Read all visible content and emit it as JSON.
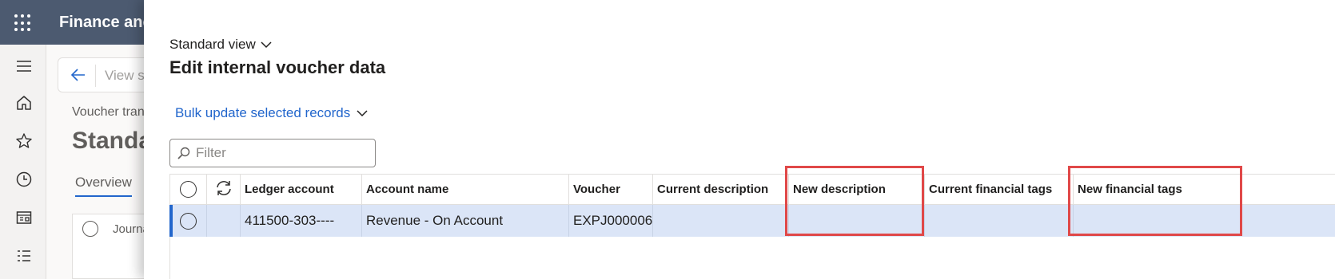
{
  "app": {
    "title": "Finance and"
  },
  "left_rail": {
    "icons": [
      "menu-icon",
      "home-icon",
      "star-icon",
      "clock-icon",
      "workspace-icon",
      "list-icon"
    ]
  },
  "background": {
    "back_text": "View s",
    "breadcrumb": "Voucher tran",
    "title": "Standa",
    "tab_overview": "Overview",
    "grid_first_col": "Journa"
  },
  "panel": {
    "view_selector": "Standard view",
    "title": "Edit internal voucher data",
    "bulk_update": "Bulk update selected records",
    "filter": {
      "placeholder": "Filter",
      "value": ""
    },
    "columns": [
      "Ledger account",
      "Account name",
      "Voucher",
      "Current description",
      "New description",
      "Current financial tags",
      "New financial tags"
    ],
    "rows": [
      {
        "ledger_account": "411500-303----",
        "account_name": "Revenue - On Account",
        "voucher": "EXPJ000006",
        "current_description": "",
        "new_description": "",
        "current_financial_tags": "",
        "new_financial_tags": ""
      }
    ]
  },
  "colors": {
    "topbar": "#4c5a70",
    "accent": "#2266cc",
    "selected_row": "#dbe5f7",
    "highlight_box": "#e04848"
  }
}
